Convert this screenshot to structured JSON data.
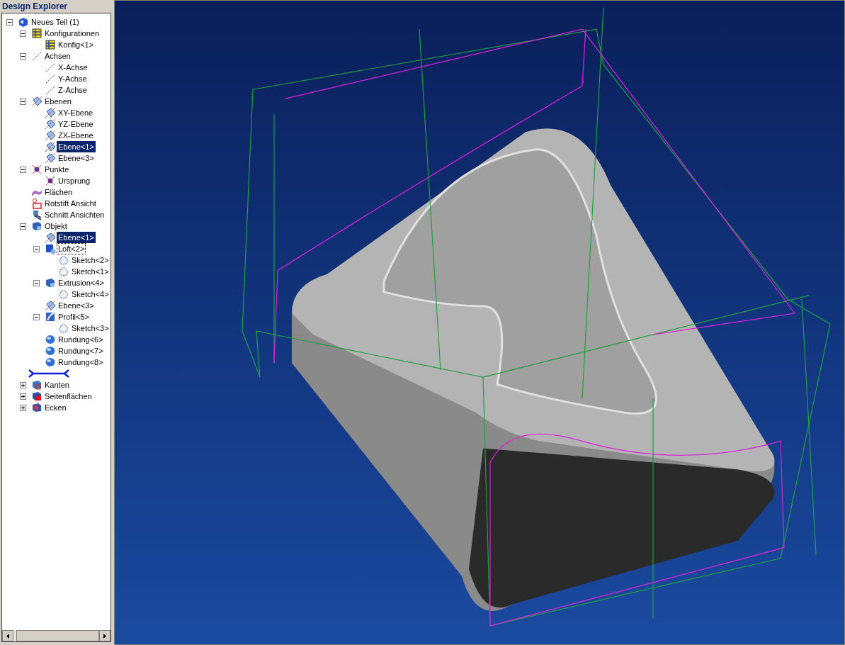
{
  "panel": {
    "title": "Design Explorer"
  },
  "tree": [
    {
      "label": "Neues Teil (1)",
      "kind": "part",
      "expanded": true,
      "selected": false,
      "focused": false,
      "children": [
        {
          "label": "Konfigurationen",
          "kind": "config",
          "expanded": true,
          "selected": false,
          "focused": false,
          "children": [
            {
              "label": "Konfig<1>",
              "kind": "config",
              "selected": false,
              "focused": false
            }
          ]
        },
        {
          "label": "Achsen",
          "kind": "axis",
          "expanded": true,
          "selected": false,
          "focused": false,
          "children": [
            {
              "label": "X-Achse",
              "kind": "axis",
              "selected": false,
              "focused": false
            },
            {
              "label": "Y-Achse",
              "kind": "axis",
              "selected": false,
              "focused": false
            },
            {
              "label": "Z-Achse",
              "kind": "axis",
              "selected": false,
              "focused": false
            }
          ]
        },
        {
          "label": "Ebenen",
          "kind": "plane",
          "expanded": true,
          "selected": false,
          "focused": false,
          "children": [
            {
              "label": "XY-Ebene",
              "kind": "plane",
              "selected": false,
              "focused": false
            },
            {
              "label": "YZ-Ebene",
              "kind": "plane",
              "selected": false,
              "focused": false
            },
            {
              "label": "ZX-Ebene",
              "kind": "plane",
              "selected": false,
              "focused": false
            },
            {
              "label": "Ebene<1>",
              "kind": "plane",
              "selected": true,
              "focused": false
            },
            {
              "label": "Ebene<3>",
              "kind": "plane",
              "selected": false,
              "focused": false
            }
          ]
        },
        {
          "label": "Punkte",
          "kind": "point",
          "expanded": true,
          "selected": false,
          "focused": false,
          "children": [
            {
              "label": "Ursprung",
              "kind": "point",
              "selected": false,
              "focused": false
            }
          ]
        },
        {
          "label": "Flächen",
          "kind": "surface",
          "selected": false,
          "focused": false
        },
        {
          "label": "Rotstift Ansicht",
          "kind": "redline",
          "selected": false,
          "focused": false
        },
        {
          "label": "Schnitt Ansichten",
          "kind": "section",
          "selected": false,
          "focused": false
        },
        {
          "label": "Objekt",
          "kind": "object",
          "expanded": true,
          "selected": false,
          "focused": false,
          "children": [
            {
              "label": "Ebene<1>",
              "kind": "plane",
              "selected": true,
              "focused": false
            },
            {
              "label": "Loft<2>",
              "kind": "loft",
              "expanded": true,
              "selected": false,
              "focused": true,
              "children": [
                {
                  "label": "Sketch<2>",
                  "kind": "sketch",
                  "selected": false,
                  "focused": false
                },
                {
                  "label": "Sketch<1>",
                  "kind": "sketch",
                  "selected": false,
                  "focused": false
                }
              ]
            },
            {
              "label": "Extrusion<4>",
              "kind": "object",
              "expanded": true,
              "selected": false,
              "focused": false,
              "children": [
                {
                  "label": "Sketch<4>",
                  "kind": "sketch",
                  "selected": false,
                  "focused": false
                }
              ]
            },
            {
              "label": "Ebene<3>",
              "kind": "plane",
              "selected": false,
              "focused": false
            },
            {
              "label": "Profil<5>",
              "kind": "profile",
              "expanded": true,
              "selected": false,
              "focused": false,
              "children": [
                {
                  "label": "Sketch<3>",
                  "kind": "sketch",
                  "selected": false,
                  "focused": false
                }
              ]
            },
            {
              "label": "Rundung<6>",
              "kind": "fillet",
              "selected": false,
              "focused": false
            },
            {
              "label": "Rundung<7>",
              "kind": "fillet",
              "selected": false,
              "focused": false
            },
            {
              "label": "Rundung<8>",
              "kind": "fillet",
              "selected": false,
              "focused": false
            }
          ]
        },
        {
          "kind": "rollback"
        },
        {
          "label": "Kanten",
          "kind": "edges",
          "expanded": false,
          "selected": false,
          "focused": false
        },
        {
          "label": "Seitenflächen",
          "kind": "faces",
          "expanded": false,
          "selected": false,
          "focused": false
        },
        {
          "label": "Ecken",
          "kind": "corners",
          "expanded": false,
          "selected": false,
          "focused": false
        }
      ]
    }
  ]
}
